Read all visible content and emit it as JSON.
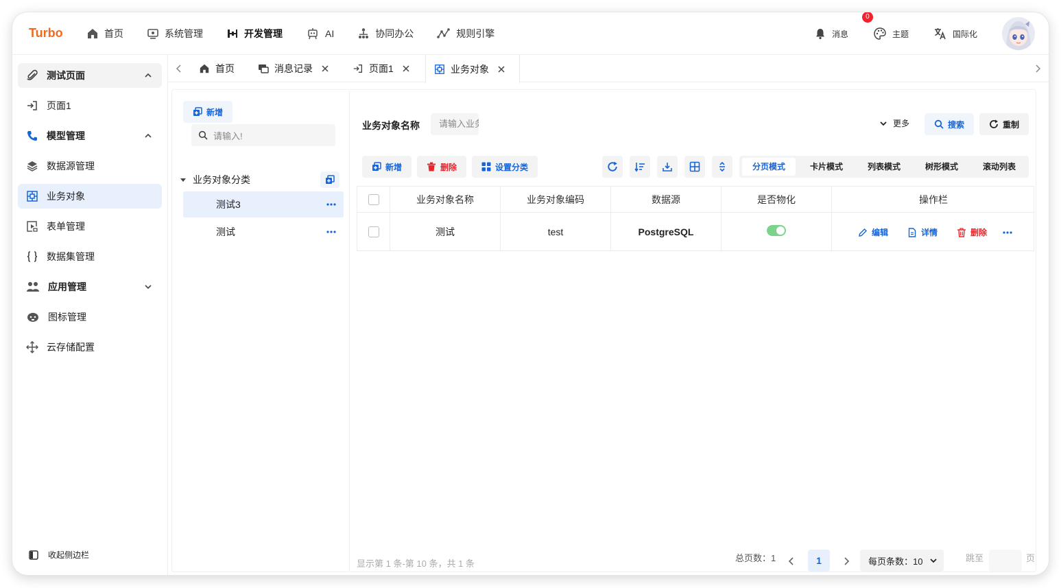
{
  "app": {
    "logo": "Turbo"
  },
  "topnav": [
    {
      "label": "首页",
      "icon": "home-icon"
    },
    {
      "label": "系统管理",
      "icon": "monitor-icon"
    },
    {
      "label": "开发管理",
      "icon": "dev-icon",
      "active": true
    },
    {
      "label": "AI",
      "icon": "robot-icon"
    },
    {
      "label": "协同办公",
      "icon": "org-icon"
    },
    {
      "label": "规则引擎",
      "icon": "graph-icon"
    }
  ],
  "topright": {
    "message_label": "消息",
    "message_count": "0",
    "theme_label": "主题",
    "i18n_label": "国际化"
  },
  "sidebar": {
    "items": [
      {
        "label": "测试页面"
      },
      {
        "label": "页面1"
      },
      {
        "label": "模型管理"
      },
      {
        "label": "数据源管理"
      },
      {
        "label": "业务对象"
      },
      {
        "label": "表单管理"
      },
      {
        "label": "数据集管理"
      },
      {
        "label": "应用管理"
      },
      {
        "label": "图标管理"
      },
      {
        "label": "云存储配置"
      }
    ],
    "collapse_label": "收起侧边栏"
  },
  "tabs": [
    {
      "label": "首页"
    },
    {
      "label": "消息记录"
    },
    {
      "label": "页面1"
    },
    {
      "label": "业务对象"
    }
  ],
  "tree": {
    "add_label": "新增",
    "search_placeholder": "请输入!",
    "root_label": "业务对象分类",
    "nodes": [
      {
        "label": "测试3"
      },
      {
        "label": "测试"
      }
    ]
  },
  "filter": {
    "name_label": "业务对象名称",
    "name_placeholder": "请输入业务对象名称",
    "more_label": "更多",
    "search_label": "搜索",
    "reset_label": "重制"
  },
  "toolbar": {
    "add_label": "新增",
    "delete_label": "删除",
    "category_label": "设置分类",
    "modes": [
      "分页模式",
      "卡片模式",
      "列表模式",
      "树形模式",
      "滚动列表"
    ]
  },
  "table": {
    "headers": [
      "业务对象名称",
      "业务对象编码",
      "数据源",
      "是否物化",
      "操作栏"
    ],
    "rows": [
      {
        "name": "测试",
        "code": "test",
        "datasource": "PostgreSQL",
        "materialized": true
      }
    ],
    "ops": {
      "edit": "编辑",
      "detail": "详情",
      "delete": "删除"
    }
  },
  "footer": {
    "summary": "显示第 1 条-第 10 条，共 1 条",
    "total_pages_label": "总页数：1",
    "current_page": "1",
    "page_size_label": "每页条数：10",
    "jump_label": "跳至",
    "page_unit": "页"
  },
  "colors": {
    "brand": "#f26a1b",
    "primary": "#1765d8",
    "danger": "#e8242c",
    "toggle_on": "#7cd48a"
  }
}
